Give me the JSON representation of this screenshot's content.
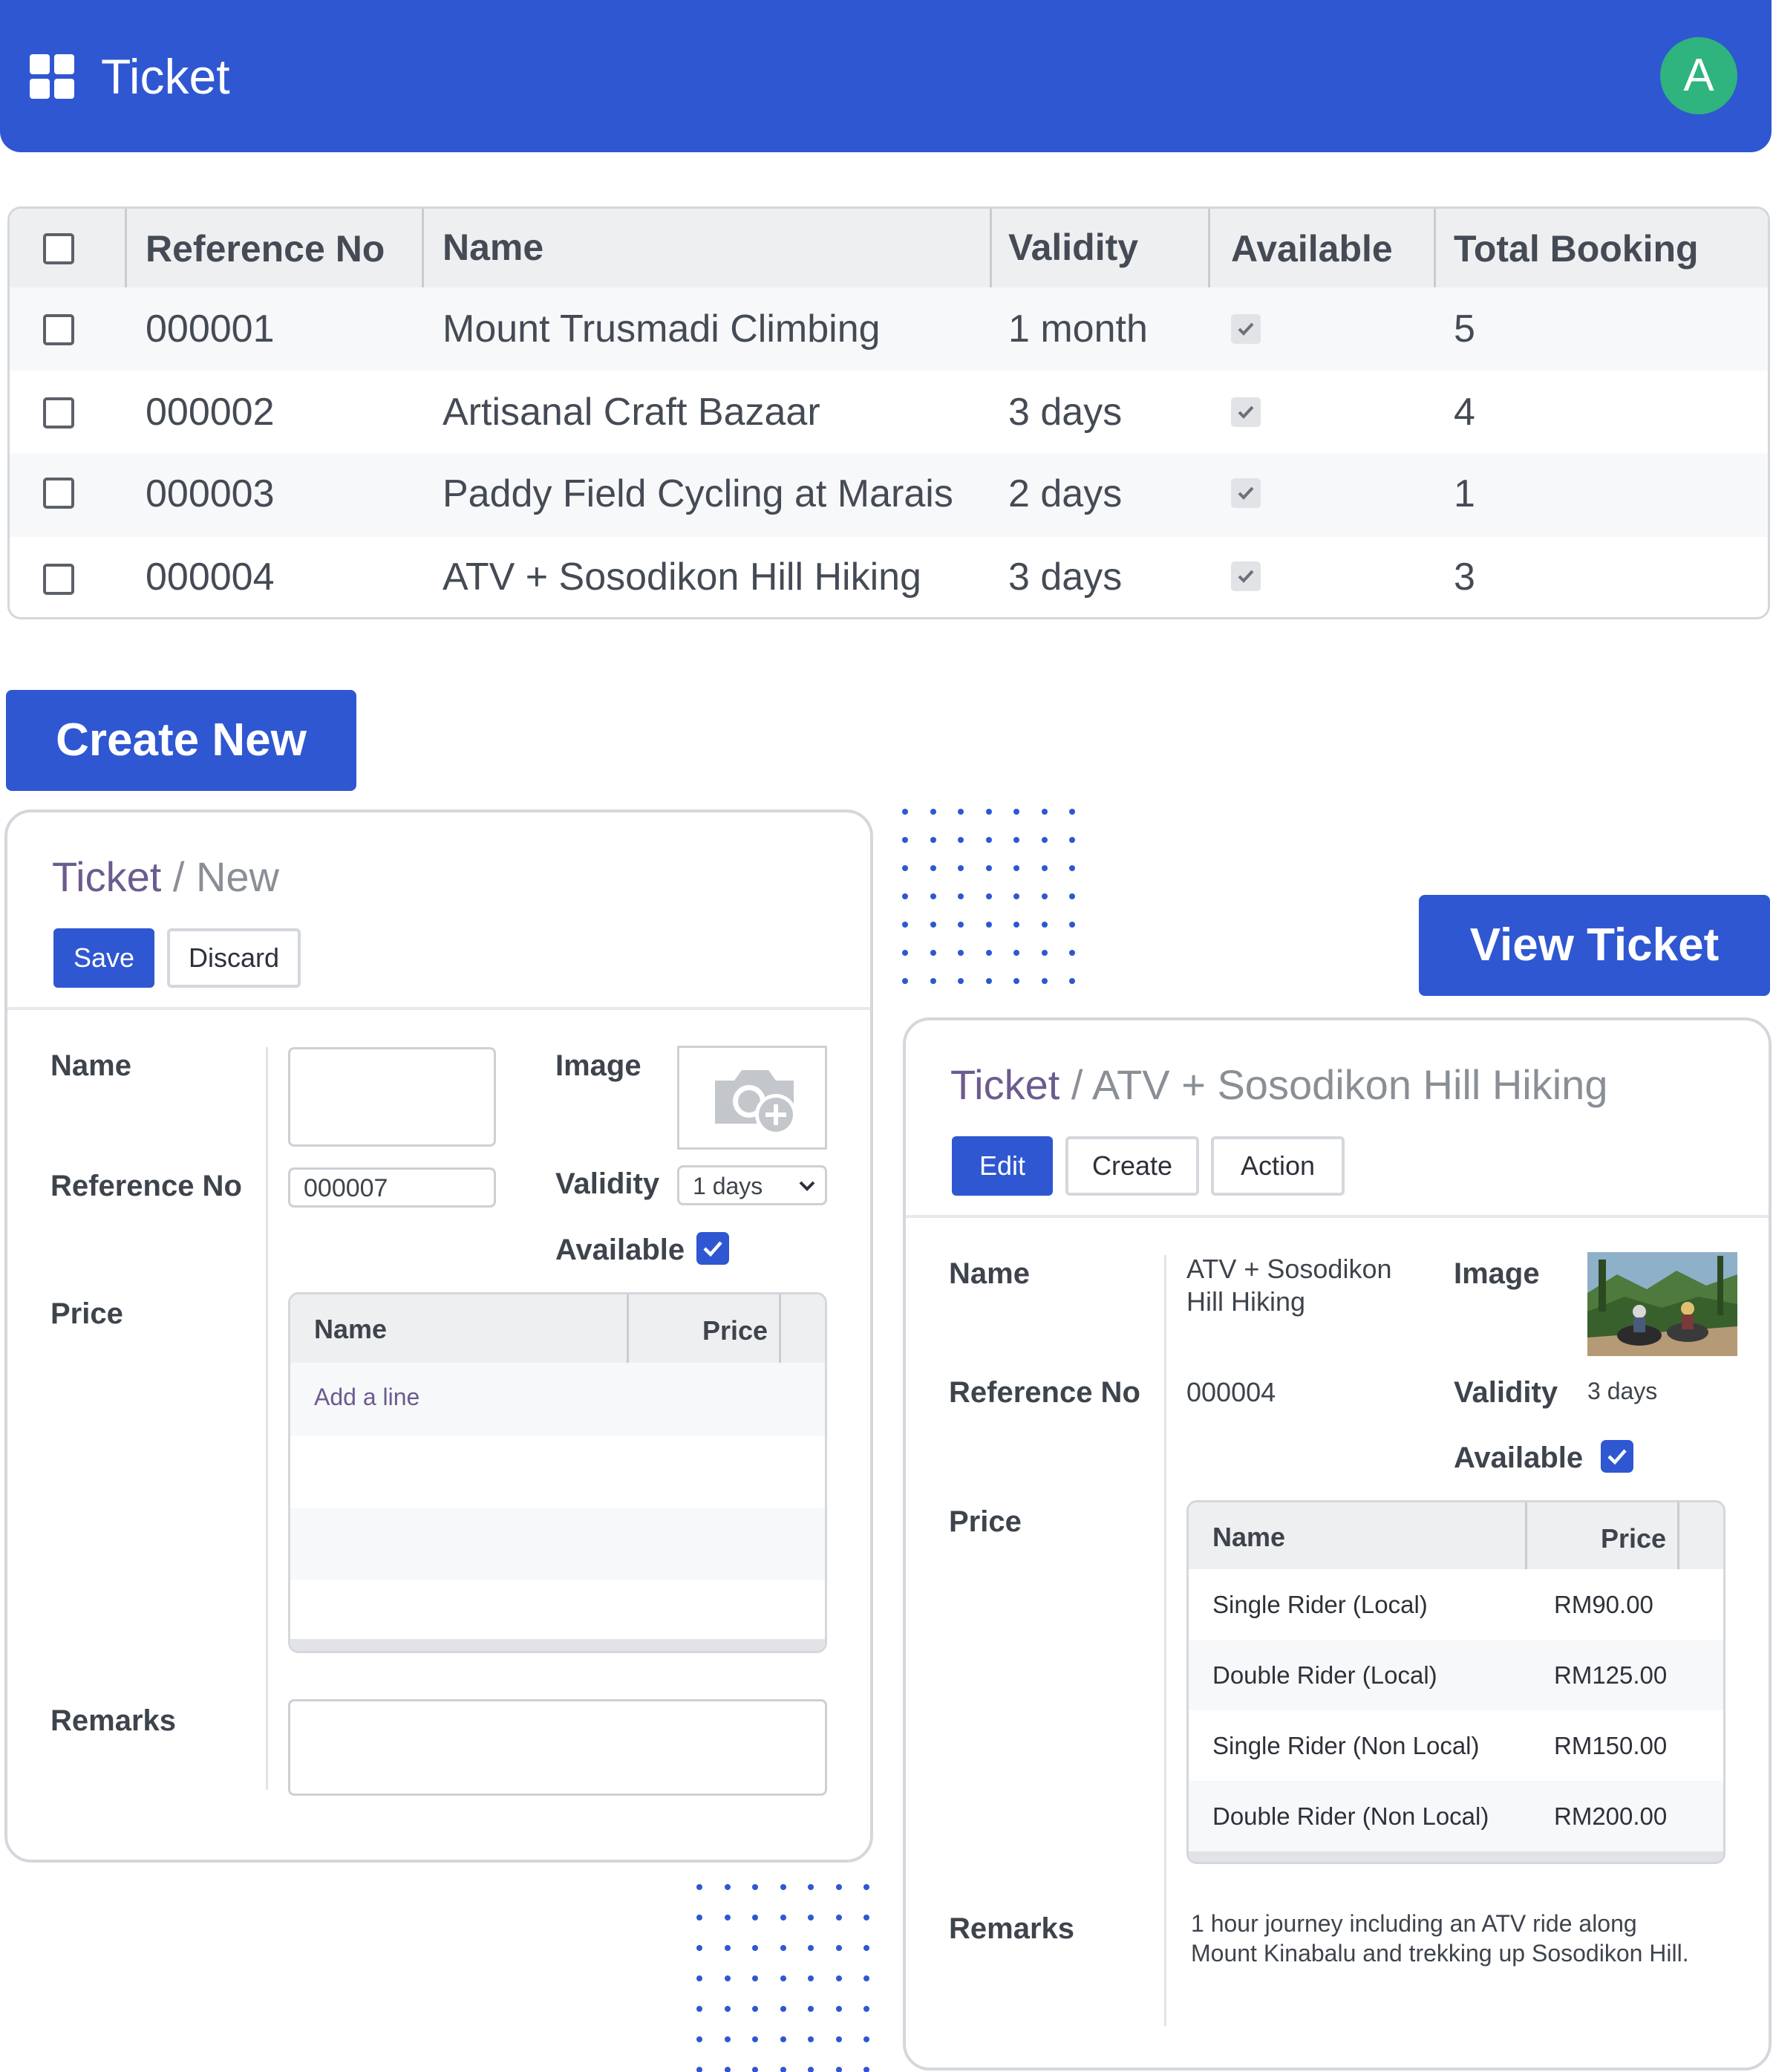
{
  "header": {
    "app_title": "Ticket",
    "avatar_initial": "A",
    "menu_icon": "apps-grid-icon"
  },
  "ticket_list": {
    "columns": [
      "Reference No",
      "Name",
      "Validity",
      "Available",
      "Total Booking"
    ],
    "rows": [
      {
        "ref": "000001",
        "name": "Mount Trusmadi Climbing",
        "validity": "1 month",
        "available": true,
        "total": "5"
      },
      {
        "ref": "000002",
        "name": "Artisanal Craft Bazaar",
        "validity": "3 days",
        "available": true,
        "total": "4"
      },
      {
        "ref": "000003",
        "name": "Paddy Field Cycling at Marais",
        "validity": "2 days",
        "available": true,
        "total": "1"
      },
      {
        "ref": "000004",
        "name": "ATV + Sosodikon Hill Hiking",
        "validity": "3 days",
        "available": true,
        "total": "3"
      }
    ]
  },
  "create_new_label": "Create New",
  "view_ticket_label": "View Ticket",
  "new_form": {
    "breadcrumb_root": "Ticket",
    "breadcrumb_sep": "/",
    "breadcrumb_current": "New",
    "save_label": "Save",
    "discard_label": "Discard",
    "name_label": "Name",
    "name_value": "",
    "image_label": "Image",
    "ref_label": "Reference No",
    "ref_value": "000007",
    "validity_label": "Validity",
    "validity_value": "1 days",
    "available_label": "Available",
    "available": true,
    "price_label": "Price",
    "price_col_name": "Name",
    "price_col_price": "Price",
    "add_line": "Add a line",
    "remarks_label": "Remarks",
    "remarks_value": ""
  },
  "view_form": {
    "breadcrumb_root": "Ticket",
    "breadcrumb_sep": "/",
    "breadcrumb_current": "ATV + Sosodikon Hill Hiking",
    "edit_label": "Edit",
    "create_label": "Create",
    "action_label": "Action",
    "name_label": "Name",
    "name_line1": "ATV + Sosodikon",
    "name_line2": "Hill Hiking",
    "image_label": "Image",
    "ref_label": "Reference No",
    "ref_value": "000004",
    "validity_label": "Validity",
    "validity_value": "3 days",
    "available_label": "Available",
    "available": true,
    "price_label": "Price",
    "price_col_name": "Name",
    "price_col_price": "Price",
    "prices": [
      {
        "name": "Single Rider (Local)",
        "price": "RM90.00"
      },
      {
        "name": "Double Rider (Local)",
        "price": "RM125.00"
      },
      {
        "name": "Single Rider (Non Local)",
        "price": "RM150.00"
      },
      {
        "name": "Double Rider (Non Local)",
        "price": "RM200.00"
      }
    ],
    "remarks_label": "Remarks",
    "remarks_line1": "1 hour journey including an ATV ride along",
    "remarks_line2": "Mount Kinabalu and trekking up Sosodikon Hill."
  },
  "colors": {
    "primary": "#2f57d1",
    "avatar": "#2fb37f",
    "breadcrumb": "#6c5b8f"
  }
}
